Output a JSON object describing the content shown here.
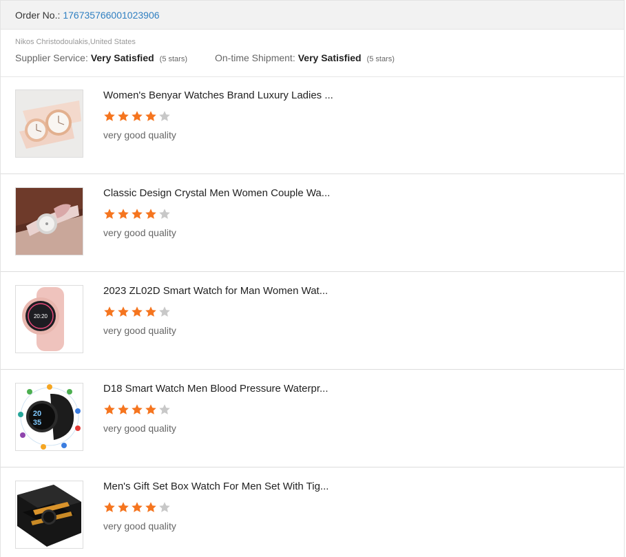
{
  "order": {
    "label": "Order No.:",
    "number": "176735766001023906"
  },
  "buyer": {
    "name_country": "Nikos Christodoulakis,United States"
  },
  "ratings": {
    "supplier": {
      "label": "Supplier Service:",
      "value": "Very Satisfied",
      "note": "(5 stars)"
    },
    "shipment": {
      "label": "On-time Shipment:",
      "value": "Very Satisfied",
      "note": "(5 stars)"
    }
  },
  "colors": {
    "star_filled": "#f5751f",
    "star_empty": "#c8c8c8",
    "link": "#2f7fc1"
  },
  "products": [
    {
      "title": "Women's Benyar Watches Brand Luxury Ladies ...",
      "rating": 4,
      "max_rating": 5,
      "review": "very good quality",
      "thumbnail": "rose-gold-ladies-watches-image"
    },
    {
      "title": "Classic Design Crystal Men Women Couple Wa...",
      "rating": 4,
      "max_rating": 5,
      "review": "very good quality",
      "thumbnail": "crystal-bracelet-watch-image"
    },
    {
      "title": "2023 ZL02D Smart Watch for Man Women Wat...",
      "rating": 4,
      "max_rating": 5,
      "review": "very good quality",
      "thumbnail": "pink-smart-watch-image",
      "watch_time": "20:20"
    },
    {
      "title": "D18 Smart Watch Men Blood Pressure Waterpr...",
      "rating": 4,
      "max_rating": 5,
      "review": "very good quality",
      "thumbnail": "black-smart-watch-image",
      "watch_digits": [
        "20",
        "35"
      ]
    },
    {
      "title": "Men's Gift Set Box Watch For Men Set With Tig...",
      "rating": 4,
      "max_rating": 5,
      "review": "very good quality",
      "thumbnail": "gift-box-watch-set-image"
    }
  ]
}
